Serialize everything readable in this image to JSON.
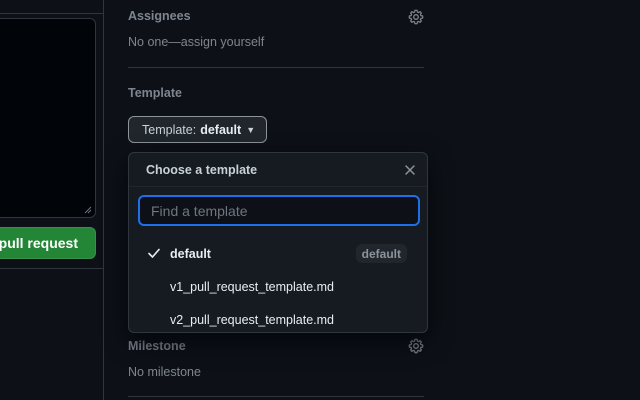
{
  "left": {
    "create_button_label": "pull request"
  },
  "sidebar": {
    "assignees": {
      "heading": "Assignees",
      "value": "No one—assign yourself"
    },
    "template": {
      "heading": "Template",
      "button_prefix": "Template:",
      "button_value": "default"
    },
    "milestone": {
      "heading": "Milestone",
      "value": "No milestone"
    }
  },
  "dropdown": {
    "title": "Choose a template",
    "search_placeholder": "Find a template",
    "items": [
      {
        "label": "default",
        "selected": true,
        "badge": "default"
      },
      {
        "label": "v1_pull_request_template.md",
        "selected": false
      },
      {
        "label": "v2_pull_request_template.md",
        "selected": false
      }
    ]
  },
  "colors": {
    "background": "#0d1117",
    "primary_button": "#238636",
    "focus_ring": "#1f6feb",
    "muted_text": "#7d8590"
  }
}
